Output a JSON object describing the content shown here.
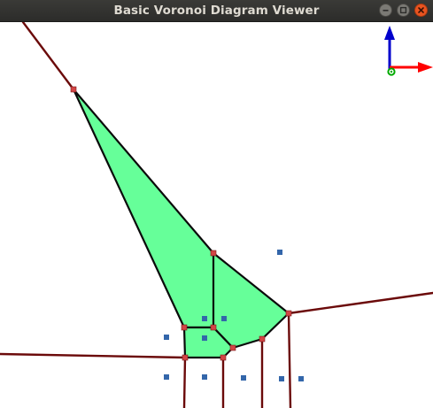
{
  "window": {
    "title": "Basic Voronoi Diagram Viewer"
  },
  "window_controls": [
    {
      "name": "minimize-button",
      "icon": "minimize-icon"
    },
    {
      "name": "maximize-button",
      "icon": "maximize-icon"
    },
    {
      "name": "close-button",
      "icon": "close-icon"
    }
  ],
  "colors": {
    "titlebar": "#2f2f2c",
    "title_text": "#dfdbd2",
    "canvas_background": "#ffffff",
    "voronoi_edge": "#6b0a0a",
    "cell_fill": "#66ff99",
    "cell_outline": "#0a0a0a",
    "vertex": "#d24545",
    "site": "#3366aa",
    "axis_x": "#ff0000",
    "axis_y": "#0000cc",
    "axis_z": "#00aa00",
    "close_button": "#e95420"
  },
  "axis_gizmo": {
    "icon": "xyz-axis-gizmo-icon"
  }
}
